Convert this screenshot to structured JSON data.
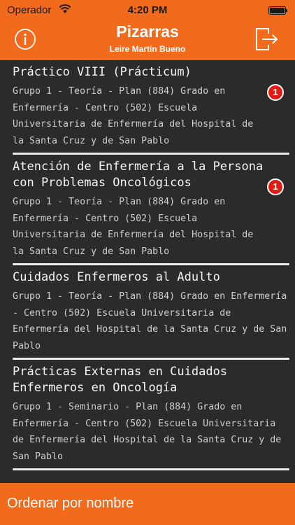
{
  "status_bar": {
    "carrier": "Operador",
    "time": "4:20 PM",
    "icons": [
      "wifi-icon",
      "battery-icon"
    ]
  },
  "nav": {
    "title": "Pizarras",
    "subtitle": "Leire Martín Bueno",
    "left_icon": "info-icon",
    "right_icon": "logout-icon"
  },
  "colors": {
    "accent": "#f26b1d",
    "board": "#2b2b2b",
    "badge": "#e21b14"
  },
  "boards": [
    {
      "course": "Práctico VIII (Prácticum)",
      "detail": "Grupo 1 - Teoría - Plan (884) Grado en Enfermería - Centro (502) Escuela Universitaria de Enfermería del Hospital de la Santa Cruz y de San Pablo",
      "badge": "1"
    },
    {
      "course": "Atención de Enfermería a la Persona con Problemas Oncológicos",
      "detail": "Grupo 1 - Teoría - Plan (884) Grado en Enfermería - Centro (502) Escuela Universitaria de Enfermería del Hospital de la Santa Cruz y de San Pablo",
      "badge": "1"
    },
    {
      "course": "Cuidados Enfermeros al Adulto",
      "detail": "Grupo 1 - Teoría - Plan (884) Grado en Enfermería - Centro (502) Escuela Universitaria de Enfermería del Hospital de la Santa Cruz y de San Pablo"
    },
    {
      "course": "Prácticas Externas en  Cuidados Enfermeros en Oncología",
      "detail": "Grupo 1 - Seminario - Plan (884) Grado en Enfermería - Centro (502) Escuela Universitaria de Enfermería del Hospital de la Santa Cruz y de San Pablo"
    }
  ],
  "bottom": {
    "sort_label": "Ordenar por nombre"
  }
}
